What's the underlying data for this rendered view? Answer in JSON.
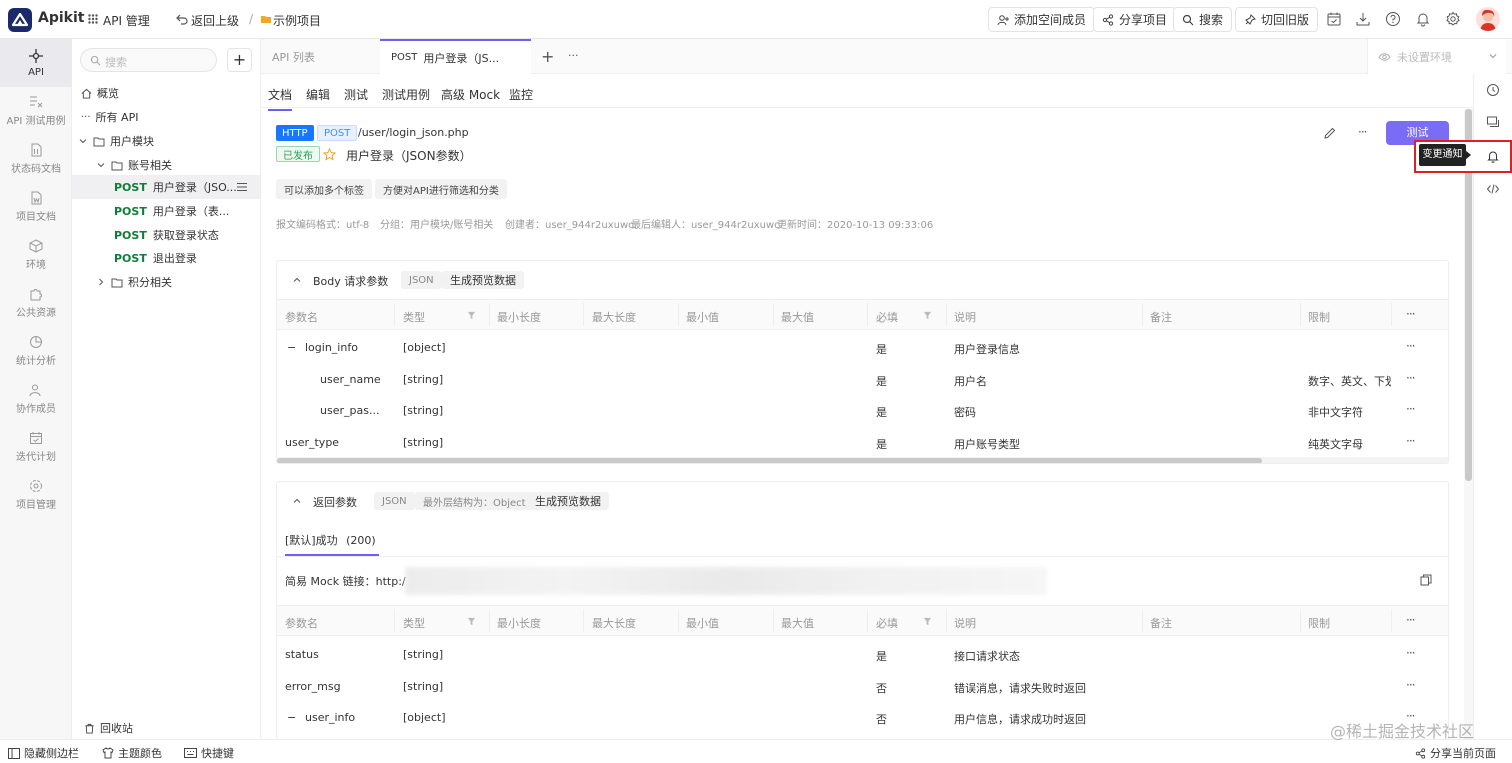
{
  "app": {
    "name": "Apikit",
    "brand_color": "#1b2a6b",
    "accent": "#6d5ff5"
  },
  "topbar": {
    "api_manage": "API 管理",
    "back_label": "返回上级",
    "separator": "/",
    "project_name": "示例项目",
    "add_member": "添加空间成员",
    "share_project": "分享项目",
    "search": "搜索",
    "switch_old": "切回旧版"
  },
  "leftnav": [
    {
      "label": "API",
      "icon": "api-icon"
    },
    {
      "label": "API 测试用例",
      "icon": "test-case-icon"
    },
    {
      "label": "状态码文档",
      "icon": "status-doc-icon"
    },
    {
      "label": "项目文档",
      "icon": "project-doc-icon"
    },
    {
      "label": "环境",
      "icon": "environment-icon"
    },
    {
      "label": "公共资源",
      "icon": "puzzle-icon"
    },
    {
      "label": "统计分析",
      "icon": "pie-chart-icon"
    },
    {
      "label": "协作成员",
      "icon": "members-icon"
    },
    {
      "label": "迭代计划",
      "icon": "calendar-icon"
    },
    {
      "label": "项目管理",
      "icon": "settings-icon"
    }
  ],
  "tree": {
    "search_placeholder": "搜索",
    "overview": "概览",
    "all_api": "所有 API",
    "group_user": "用户模块",
    "group_account": "账号相关",
    "items": [
      {
        "method": "POST",
        "name": "用户登录（JSO..."
      },
      {
        "method": "POST",
        "name": "用户登录（表..."
      },
      {
        "method": "POST",
        "name": "获取登录状态"
      },
      {
        "method": "POST",
        "name": "退出登录"
      }
    ],
    "group_points": "积分相关",
    "recycle": "回收站"
  },
  "tabs": {
    "api_list": "API 列表",
    "current_method": "POST",
    "current_name": "用户登录（JS...",
    "add": "+",
    "more": "···",
    "env": "未设置环境"
  },
  "subtabs": [
    "文档",
    "编辑",
    "测试",
    "测试用例",
    "高级 Mock",
    "监控"
  ],
  "api": {
    "protocol": "HTTP",
    "method": "POST",
    "path": "/user/login_json.php",
    "status": "已发布",
    "name": "用户登录（JSON参数）",
    "test_button": "测试",
    "tooltip": "变更通知",
    "tags": [
      "可以添加多个标签",
      "方便对API进行筛选和分类"
    ],
    "meta": {
      "encoding": "报文编码格式：utf-8",
      "group": "分组：用户模块/账号相关",
      "creator": "创建者：user_944r2uxuwc",
      "editor": "最后编辑人：user_944r2uxuwc",
      "updated": "更新时间：2020-10-13 09:33:06"
    }
  },
  "body_params": {
    "title": "Body 请求参数",
    "format": "JSON",
    "preview": "生成预览数据",
    "headers": [
      "参数名",
      "类型",
      "最小长度",
      "最大长度",
      "最小值",
      "最大值",
      "必填",
      "说明",
      "备注",
      "限制"
    ],
    "rows": [
      {
        "name": "login_info",
        "type": "[object]",
        "required": "是",
        "desc": "用户登录信息",
        "limit": "",
        "toggle": "−"
      },
      {
        "name": "user_name",
        "type": "[string]",
        "required": "是",
        "desc": "用户名",
        "limit": "数字、英文、下划",
        "toggle": ""
      },
      {
        "name": "user_pas...",
        "type": "[string]",
        "required": "是",
        "desc": "密码",
        "limit": "非中文字符",
        "toggle": ""
      },
      {
        "name": "user_type",
        "type": "[string]",
        "required": "是",
        "desc": "用户账号类型",
        "limit": "纯英文字母",
        "toggle": ""
      }
    ]
  },
  "response": {
    "title": "返回参数",
    "format": "JSON",
    "outer": "最外层结构为：Object",
    "preview": "生成预览数据",
    "tab": "[默认]成功",
    "code": "(200)",
    "mock_label": "简易 Mock 链接：http:/",
    "headers": [
      "参数名",
      "类型",
      "最小长度",
      "最大长度",
      "最小值",
      "最大值",
      "必填",
      "说明",
      "备注",
      "限制"
    ],
    "rows": [
      {
        "name": "status",
        "type": "[string]",
        "required": "是",
        "desc": "接口请求状态",
        "toggle": ""
      },
      {
        "name": "error_msg",
        "type": "[string]",
        "required": "否",
        "desc": "错误消息，请求失败时返回",
        "toggle": ""
      },
      {
        "name": "user_info",
        "type": "[object]",
        "required": "否",
        "desc": "用户信息，请求成功时返回",
        "toggle": "−"
      }
    ]
  },
  "footer": {
    "hide_sidebar": "隐藏侧边栏",
    "theme": "主题颜色",
    "shortcuts": "快捷键",
    "share_page": "分享当前页面",
    "watermark": "@稀土掘金技术社区"
  }
}
